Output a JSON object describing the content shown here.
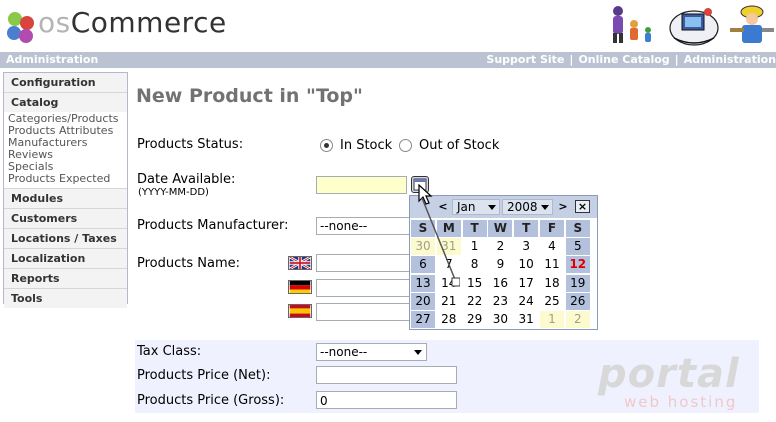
{
  "logo": {
    "prefix": "os",
    "name": "Commerce"
  },
  "topbar": {
    "left": "Administration",
    "links": [
      "Support Site",
      "Online Catalog",
      "Administration"
    ],
    "separator": "|"
  },
  "sidebar": {
    "sections": [
      {
        "label": "Configuration"
      },
      {
        "label": "Catalog",
        "items": [
          "Categories/Products",
          "Products Attributes",
          "Manufacturers",
          "Reviews",
          "Specials",
          "Products Expected"
        ]
      },
      {
        "label": "Modules"
      },
      {
        "label": "Customers"
      },
      {
        "label": "Locations / Taxes"
      },
      {
        "label": "Localization"
      },
      {
        "label": "Reports"
      },
      {
        "label": "Tools"
      }
    ]
  },
  "page": {
    "title": "New Product in \"Top\""
  },
  "form": {
    "status": {
      "label": "Products Status:",
      "option_in": "In Stock",
      "option_out": "Out of Stock",
      "selected": "In Stock"
    },
    "date": {
      "label": "Date Available:",
      "hint": "(YYYY-MM-DD)",
      "value": ""
    },
    "manufacturer": {
      "label": "Products Manufacturer:",
      "value": "--none--"
    },
    "name": {
      "label": "Products Name:",
      "flags": [
        "english-flag",
        "german-flag",
        "spanish-flag"
      ]
    },
    "tax": {
      "label": "Tax Class:",
      "value": "--none--"
    },
    "price_net": {
      "label": "Products Price (Net):",
      "value": ""
    },
    "price_gross": {
      "label": "Products Price (Gross):",
      "value": "0"
    }
  },
  "calendar": {
    "prev": "<",
    "next": ">",
    "close": "×",
    "month": "Jan",
    "year": "2008",
    "days_of_week": [
      "S",
      "M",
      "T",
      "W",
      "T",
      "F",
      "S"
    ],
    "weeks": [
      [
        "30",
        "31",
        "1",
        "2",
        "3",
        "4",
        "5"
      ],
      [
        "6",
        "7",
        "8",
        "9",
        "10",
        "11",
        "12"
      ],
      [
        "13",
        "14",
        "15",
        "16",
        "17",
        "18",
        "19"
      ],
      [
        "20",
        "21",
        "22",
        "23",
        "24",
        "25",
        "26"
      ],
      [
        "27",
        "28",
        "29",
        "30",
        "31",
        "1",
        "2"
      ]
    ],
    "today": "12"
  },
  "watermark": {
    "word": "portal",
    "sub": "web hosting"
  },
  "colors": {
    "topbar": "#bbc3d3",
    "calendar_header": "#c6d0e4",
    "weekend": "#b3c1dd",
    "other_month": "#fcfbd0",
    "today": "#e00000"
  }
}
